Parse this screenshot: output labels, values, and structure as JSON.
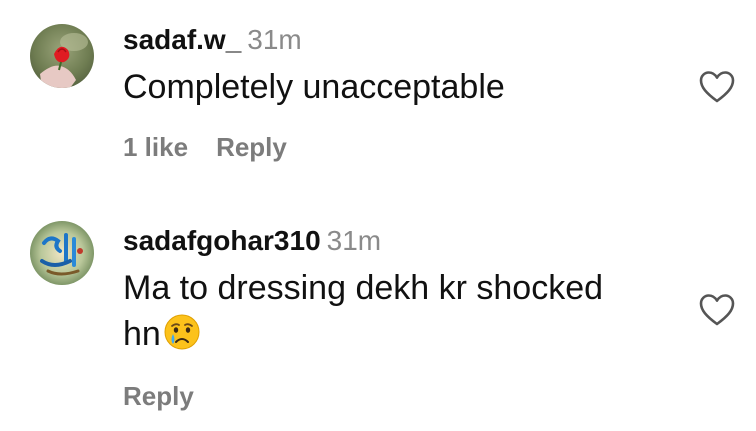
{
  "comments": [
    {
      "username": "sadaf.w_",
      "time": "31m",
      "text": "Completely unacceptable",
      "likes": "1 like",
      "reply": "Reply",
      "avatar": "rose-photo-avatar"
    },
    {
      "username": "sadafgohar310",
      "time": "31m",
      "text_line1": "Ma to dressing dekh kr shocked",
      "text_line2": "hn",
      "emoji": "crying-face-emoji",
      "reply": "Reply",
      "avatar": "calligraphy-avatar"
    }
  ],
  "colors": {
    "text": "#111111",
    "muted": "#8a8a8a",
    "action": "#7c7c7c",
    "icon": "#555555"
  },
  "icons": {
    "like": "heart-outline-icon"
  }
}
